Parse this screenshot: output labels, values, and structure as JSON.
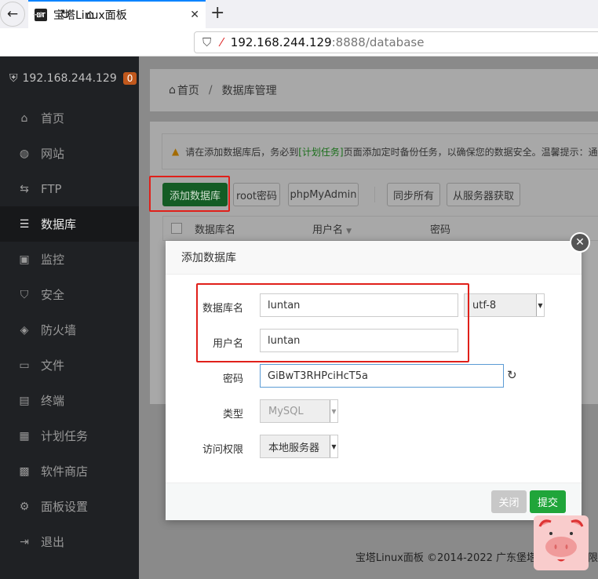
{
  "browser": {
    "tab_title": "宝塔Linux面板",
    "tab_favicon": "BT",
    "url_host": "192.168.244.129",
    "url_rest": ":8888/database"
  },
  "sidebar": {
    "server": "192.168.244.129",
    "badge": "0",
    "items": [
      {
        "label": "首页",
        "icon": "home-icon"
      },
      {
        "label": "网站",
        "icon": "globe-icon"
      },
      {
        "label": "FTP",
        "icon": "ftp-icon"
      },
      {
        "label": "数据库",
        "icon": "database-icon",
        "active": true
      },
      {
        "label": "监控",
        "icon": "monitor-icon"
      },
      {
        "label": "安全",
        "icon": "shield-icon"
      },
      {
        "label": "防火墙",
        "icon": "firewall-icon"
      },
      {
        "label": "文件",
        "icon": "folder-icon"
      },
      {
        "label": "终端",
        "icon": "terminal-icon"
      },
      {
        "label": "计划任务",
        "icon": "calendar-icon"
      },
      {
        "label": "软件商店",
        "icon": "grid-icon"
      },
      {
        "label": "面板设置",
        "icon": "gear-icon"
      },
      {
        "label": "退出",
        "icon": "logout-icon"
      }
    ]
  },
  "breadcrumb": {
    "home": "首页",
    "sep": "/",
    "current": "数据库管理"
  },
  "notice": {
    "pre": "请在添加数据库后，务必到",
    "link": "[计划任务]",
    "post": "页面添加定时备份任务，以确保您的数据安全。温馨提示：通"
  },
  "toolbar": {
    "add": "添加数据库",
    "root": "root密码",
    "pma": "phpMyAdmin",
    "sync": "同步所有",
    "fetch": "从服务器获取"
  },
  "table": {
    "headers": [
      "数据库名",
      "用户名",
      "密码"
    ]
  },
  "dialog": {
    "title": "添加数据库",
    "fields": {
      "dbname_label": "数据库名",
      "dbname": "luntan",
      "charset": "utf-8",
      "user_label": "用户名",
      "user": "luntan",
      "pass_label": "密码",
      "pass": "GiBwT3RHPciHcT5a",
      "type_label": "类型",
      "type": "MySQL",
      "access_label": "访问权限",
      "access": "本地服务器"
    },
    "close": "关闭",
    "submit": "提交"
  },
  "footer": "宝塔Linux面板 ©2014-2022 广东堡塔安全技术有限",
  "colors": {
    "accent": "#20a53a",
    "alert": "#e0201a",
    "badge": "#c1581c"
  }
}
